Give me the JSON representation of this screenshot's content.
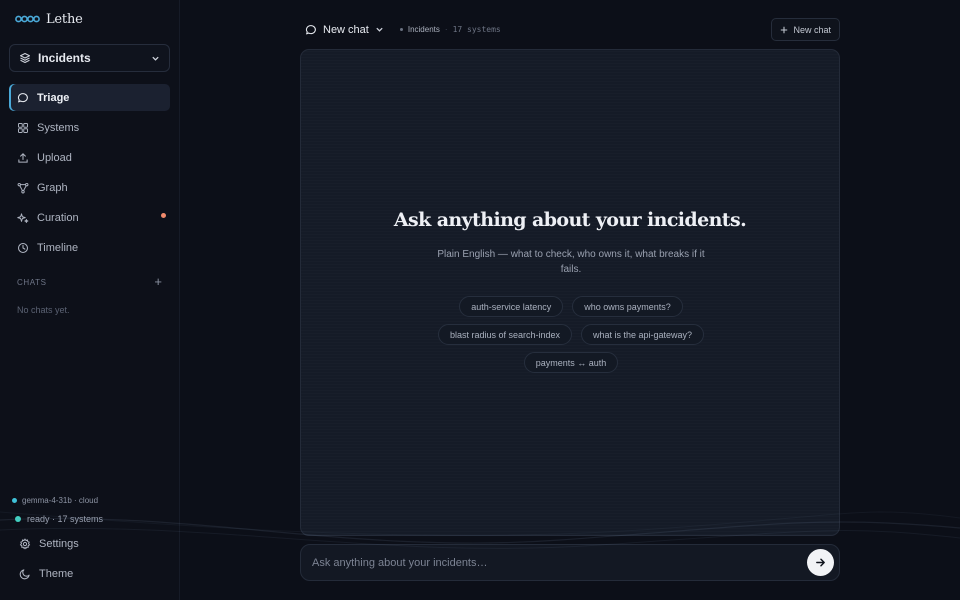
{
  "brand": {
    "name": "Lethe",
    "icon": "infinity-logo-icon",
    "accent": "#4aa9d8"
  },
  "sidebar": {
    "workspace": {
      "label": "Incidents",
      "icon": "layers-icon"
    },
    "nav": [
      {
        "label": "Triage",
        "icon": "chat-bubble-icon",
        "active": true
      },
      {
        "label": "Systems",
        "icon": "grid-icon"
      },
      {
        "label": "Upload",
        "icon": "upload-icon"
      },
      {
        "label": "Graph",
        "icon": "graph-icon"
      },
      {
        "label": "Curation",
        "icon": "sparkle-icon",
        "badge_color": "#f08a6c"
      },
      {
        "label": "Timeline",
        "icon": "clock-icon"
      }
    ],
    "chats": {
      "title": "CHATS",
      "add": "+",
      "empty": "No chats yet."
    },
    "model": "gemma-4-31b · cloud",
    "status": "ready · 17 systems",
    "settings": "Settings",
    "theme": "Theme"
  },
  "topbar": {
    "chat_title": "New chat",
    "workspace": "Incidents",
    "separator": "·",
    "count": "17 systems",
    "new_chat": "New chat"
  },
  "hero": {
    "title": "Ask anything about your incidents.",
    "subtitle": "Plain English — what to check, who owns it, what breaks if it fails."
  },
  "suggestions": [
    "auth-service latency",
    "who owns payments?",
    "blast radius of search-index",
    "what is the api-gateway?",
    "payments ↔ auth"
  ],
  "composer": {
    "placeholder": "Ask anything about your incidents…",
    "send_icon": "arrow-right-icon"
  }
}
